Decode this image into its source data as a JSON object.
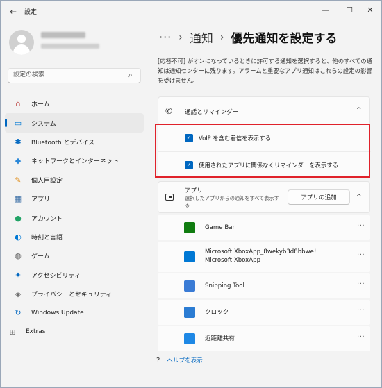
{
  "window": {
    "title": "設定",
    "back": "←",
    "minimize": "—",
    "maximize": "☐",
    "close": "✕"
  },
  "search": {
    "placeholder": "設定の検索",
    "icon": "⌕"
  },
  "nav": {
    "items": [
      {
        "label": "ホーム",
        "icon": "⌂",
        "color": "#c0504d"
      },
      {
        "label": "システム",
        "icon": "▭",
        "color": "#0078d4"
      },
      {
        "label": "Bluetooth とデバイス",
        "icon": "✱",
        "color": "#0067c0"
      },
      {
        "label": "ネットワークとインターネット",
        "icon": "◆",
        "color": "#2b88d8"
      },
      {
        "label": "個人用設定",
        "icon": "✎",
        "color": "#e08e1b"
      },
      {
        "label": "アプリ",
        "icon": "▦",
        "color": "#3a6ea5"
      },
      {
        "label": "アカウント",
        "icon": "●",
        "color": "#21a366"
      },
      {
        "label": "時刻と言語",
        "icon": "◐",
        "color": "#0078d4"
      },
      {
        "label": "ゲーム",
        "icon": "◍",
        "color": "#6b6b6b"
      },
      {
        "label": "アクセシビリティ",
        "icon": "✦",
        "color": "#0067c0"
      },
      {
        "label": "プライバシーとセキュリティ",
        "icon": "◈",
        "color": "#6b6b6b"
      },
      {
        "label": "Windows Update",
        "icon": "↻",
        "color": "#0067c0"
      },
      {
        "label": "Extras",
        "icon": "⊞",
        "color": "#333333"
      }
    ]
  },
  "header": {
    "more": "···",
    "sep1": "›",
    "parent": "通知",
    "sep2": "›",
    "current": "優先通知を設定する"
  },
  "description": "[応答不可] がオンになっているときに許可する通知を選択すると、他のすべての通知は通知センターに残ります。アラームと重要なアプリ通知はこれらの設定の影響を受けません。",
  "calls": {
    "icon": "✆",
    "title": "通話とリマインダー",
    "chevron": "^",
    "options": [
      {
        "label": "VoIP を含む着信を表示する",
        "check": "✓"
      },
      {
        "label": "使用されたアプリに関係なくリマインダーを表示する",
        "check": "✓"
      }
    ]
  },
  "apps": {
    "title": "アプリ",
    "subtitle": "選択したアプリからの通知をすべて表示する",
    "add_button": "アプリの追加",
    "chevron": "^",
    "list": [
      {
        "name": "Game Bar",
        "icon_color": "#107c10",
        "more": "···"
      },
      {
        "name": "Microsoft.XboxApp_8wekyb3d8bbwe!\nMicrosoft.XboxApp",
        "icon_color": "#0078d4",
        "more": "···"
      },
      {
        "name": "Snipping Tool",
        "icon_color": "#3a7bd5",
        "more": "···"
      },
      {
        "name": "クロック",
        "icon_color": "#2b7cd3",
        "more": "···"
      },
      {
        "name": "近距離共有",
        "icon_color": "#1e88e5",
        "more": "···"
      }
    ]
  },
  "help": {
    "icon": "?",
    "label": "ヘルプを表示"
  }
}
